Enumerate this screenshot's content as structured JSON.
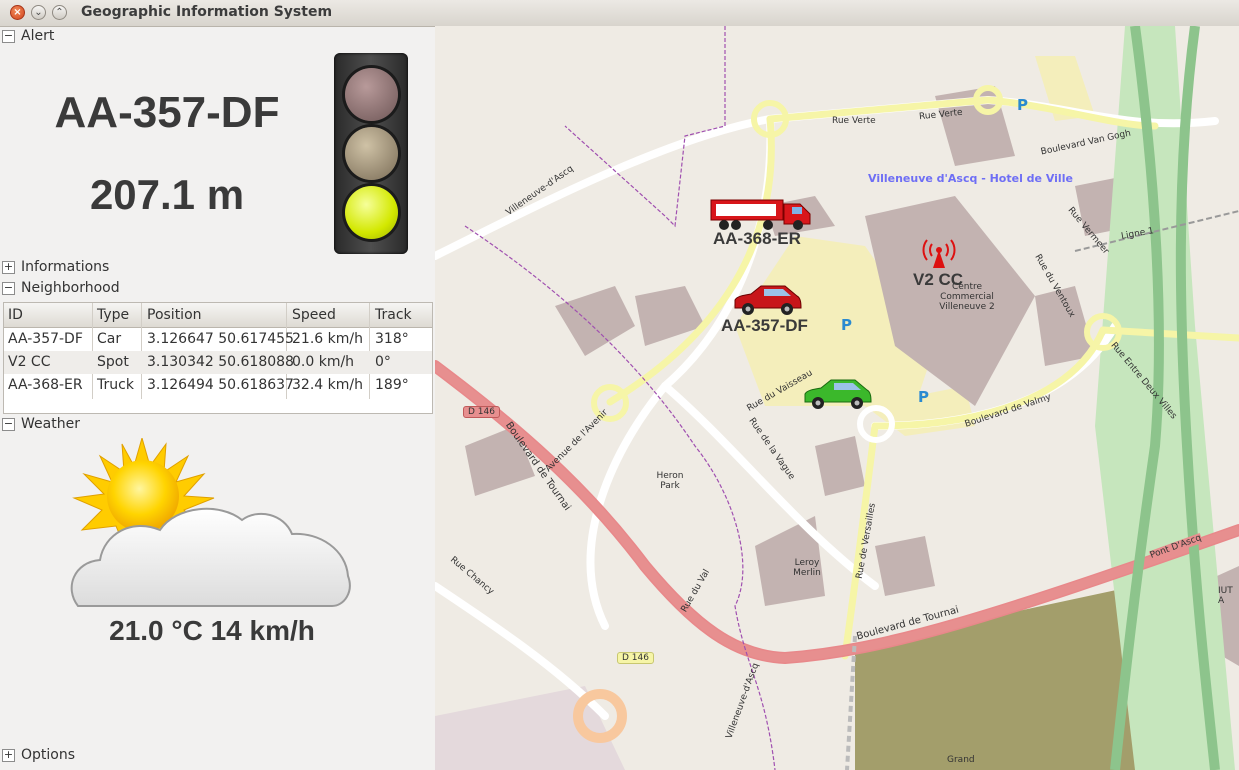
{
  "window": {
    "title": "Geographic Information System"
  },
  "sections": {
    "alert": "Alert",
    "informations": "Informations",
    "neighborhood": "Neighborhood",
    "weather": "Weather",
    "options": "Options"
  },
  "alert": {
    "plate": "AA-357-DF",
    "distance": "207.1 m",
    "light_state": "green"
  },
  "neighborhood": {
    "headers": [
      "ID",
      "Type",
      "Position",
      "Speed",
      "Track"
    ],
    "rows": [
      {
        "id": "AA-357-DF",
        "type": "Car",
        "position": "3.126647 50.617455",
        "speed": "21.6 km/h",
        "track": "318°"
      },
      {
        "id": "V2 CC",
        "type": "Spot",
        "position": "3.130342 50.618088",
        "speed": "0.0 km/h",
        "track": "0°"
      },
      {
        "id": "AA-368-ER",
        "type": "Truck",
        "position": "3.126494 50.618637",
        "speed": "32.4 km/h",
        "track": "189°"
      }
    ]
  },
  "weather": {
    "reading": "21.0 °C 14 km/h",
    "icon": "sun-behind-cloud-icon"
  },
  "map": {
    "vehicles": {
      "truck": "AA-368-ER",
      "car": "AA-357-DF",
      "spot": "V2 CC"
    },
    "labels": {
      "hotel_de_ville": "Villeneuve d'Ascq - Hotel de Ville",
      "rue_verte": "Rue Verte",
      "rue_verte_2": "Rue Verte",
      "bd_van_gogh": "Boulevard Van Gogh",
      "villeneuve_dascq_nw": "Villeneuve-d'Ascq",
      "villeneuve_dascq_s": "Villeneuve-d'Ascq",
      "bd_de_tournai": "Boulevard de Tournai",
      "bd_de_tournai_2": "Boulevard de Tournai",
      "d146": "D 146",
      "d146_2": "D 146",
      "heron_park": "Heron Park",
      "leroy_merlin": "Leroy Merlin",
      "centre_commercial": "Centre Commercial Villeneuve 2",
      "bd_de_valmy": "Boulevard de Valmy",
      "rue_de_versailles": "Rue de Versailles",
      "rue_du_val": "Rue du Val",
      "rue_chancy": "Rue Chancy",
      "pont_dascq": "Pont D'Ascq",
      "grand": "Grand",
      "avenue_de_lavenir": "Avenue de l'Avenir",
      "rue_du_vaisseau": "Rue du Vaisseau",
      "rue_de_la_vague": "Rue de la Vague",
      "rue_du_ventoux": "Rue du Ventoux",
      "rue_vermeer": "Rue Vermeer",
      "rue_entre_deux_villes": "Rue Entre Deux Villes",
      "ligne1": "Ligne 1",
      "parking": "P",
      "iut": "IUT A"
    }
  }
}
